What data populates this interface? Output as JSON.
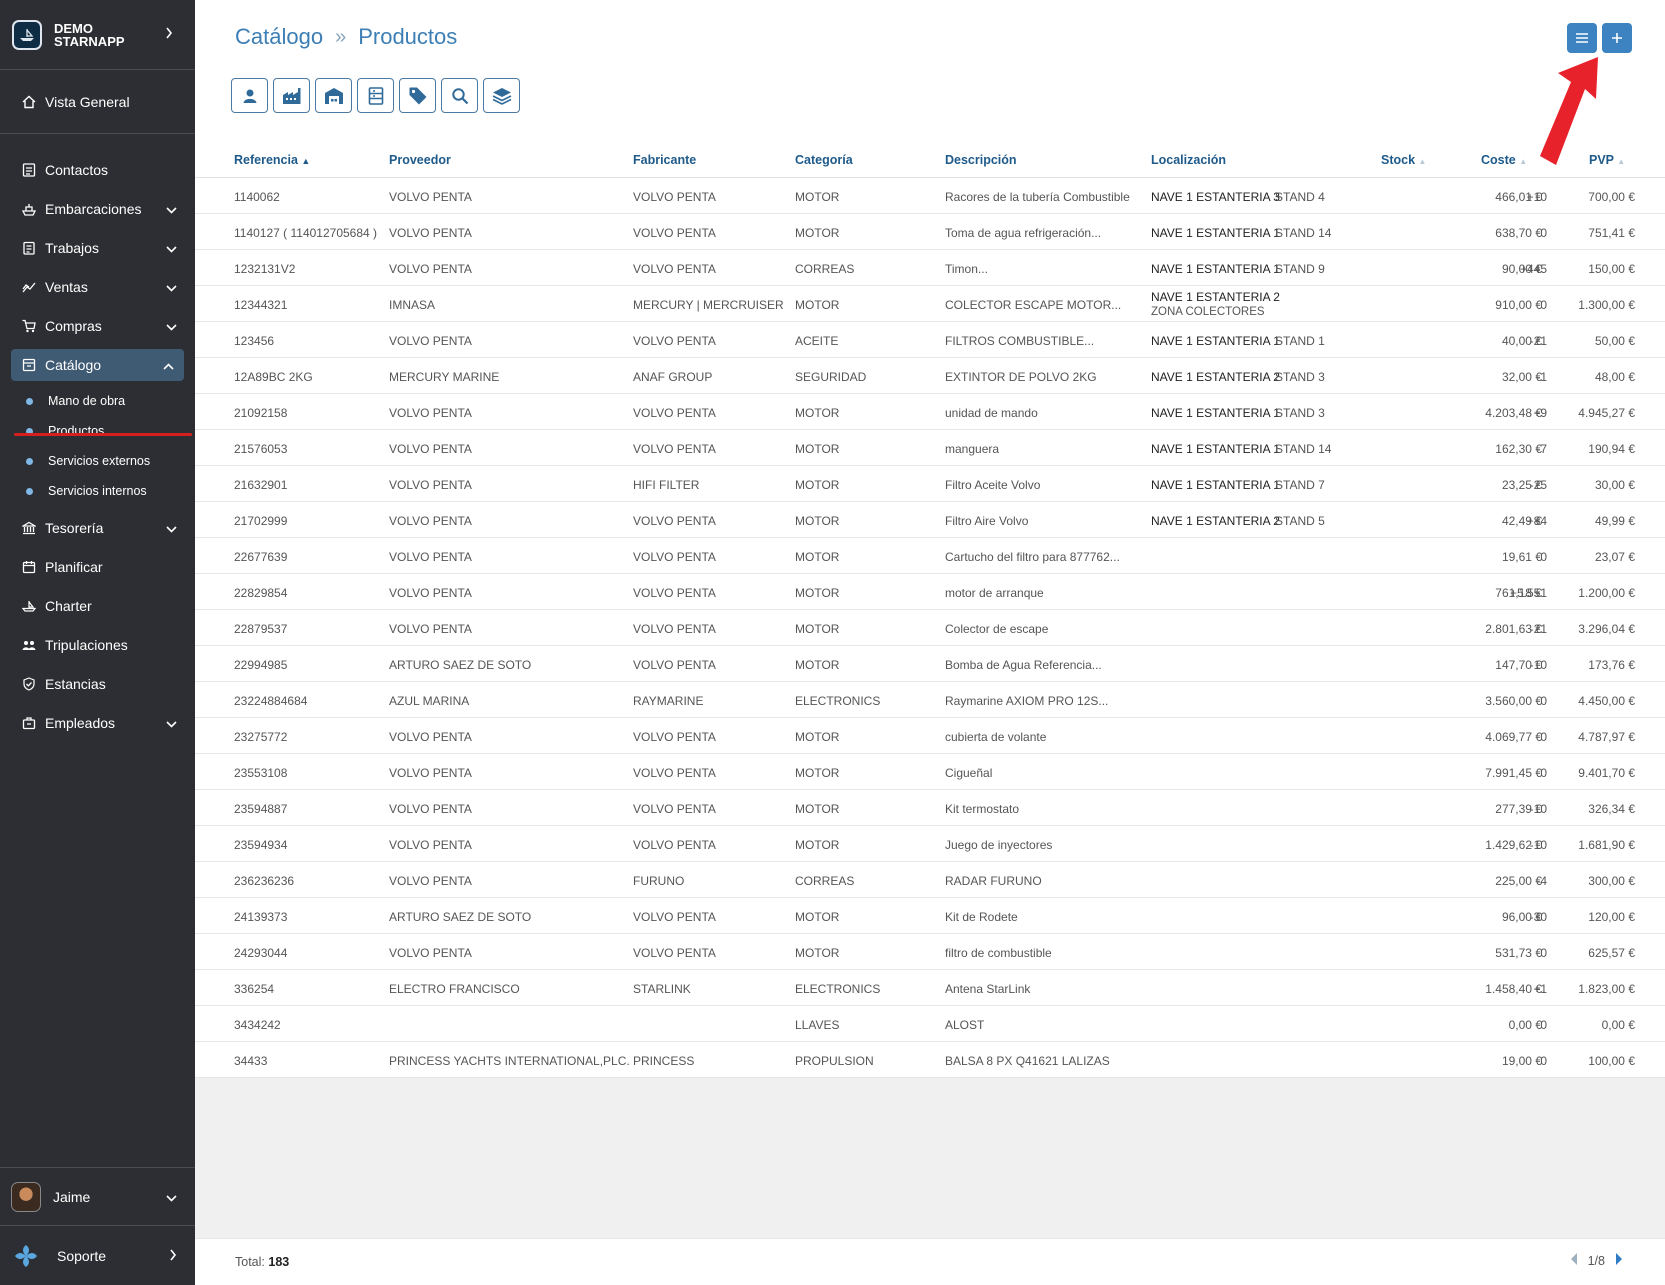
{
  "app": {
    "name_line1": "DEMO",
    "name_line2": "STARNAPP"
  },
  "sidebar": {
    "items": [
      {
        "label": "Vista General"
      },
      {
        "label": "Contactos"
      },
      {
        "label": "Embarcaciones"
      },
      {
        "label": "Trabajos"
      },
      {
        "label": "Ventas"
      },
      {
        "label": "Compras"
      },
      {
        "label": "Catálogo"
      },
      {
        "label": "Tesorería"
      },
      {
        "label": "Planificar"
      },
      {
        "label": "Charter"
      },
      {
        "label": "Tripulaciones"
      },
      {
        "label": "Estancias"
      },
      {
        "label": "Empleados"
      }
    ],
    "catalog_sub": [
      {
        "label": "Mano de obra"
      },
      {
        "label": "Productos"
      },
      {
        "label": "Servicios externos"
      },
      {
        "label": "Servicios internos"
      }
    ],
    "user": "Jaime",
    "support": "Soporte"
  },
  "breadcrumb": {
    "parent": "Catálogo",
    "current": "Productos"
  },
  "table": {
    "headers": {
      "ref": "Referencia",
      "prov": "Proveedor",
      "fab": "Fabricante",
      "cat": "Categoría",
      "desc": "Descripción",
      "loc": "Localización",
      "stock": "Stock",
      "coste": "Coste",
      "pvp": "PVP"
    },
    "rows": [
      {
        "ref": "1140062",
        "prov": "VOLVO PENTA",
        "fab": "VOLVO PENTA",
        "cat": "MOTOR",
        "desc": "Racores de la tubería Combustible",
        "loc1": "NAVE 1 ESTANTERIA 3",
        "loc2": "STAND 4",
        "stock": "+10",
        "coste": "466,01 €",
        "pvp": "700,00 €"
      },
      {
        "ref": "1140127 ( 114012705684 )",
        "prov": "VOLVO PENTA",
        "fab": "VOLVO PENTA",
        "cat": "MOTOR",
        "desc": "Toma de agua refrigeración...",
        "loc1": "NAVE 1 ESTANTERIA 1",
        "loc2": "STAND 14",
        "stock": "0",
        "coste": "638,70 €",
        "pvp": "751,41 €"
      },
      {
        "ref": "1232131V2",
        "prov": "VOLVO PENTA",
        "fab": "VOLVO PENTA",
        "cat": "CORREAS",
        "desc": "Timon...",
        "loc1": "NAVE 1 ESTANTERIA 1",
        "loc2": "STAND 9",
        "stock": "+445",
        "coste": "90,00 €",
        "pvp": "150,00 €"
      },
      {
        "ref": "12344321",
        "prov": "IMNASA",
        "fab": "MERCURY | MERCRUISER",
        "cat": "MOTOR",
        "desc": "COLECTOR ESCAPE MOTOR...",
        "loc1": "NAVE 1 ESTANTERIA 2",
        "loc2": "ZONA COLECTORES",
        "stock": "0",
        "coste": "910,00 €",
        "pvp": "1.300,00 €"
      },
      {
        "ref": "123456",
        "prov": "VOLVO PENTA",
        "fab": "VOLVO PENTA",
        "cat": "ACEITE",
        "desc": "FILTROS COMBUSTIBLE...",
        "loc1": "NAVE 1 ESTANTERIA 1",
        "loc2": "STAND 1",
        "stock": "-21",
        "coste": "40,00 €",
        "pvp": "50,00 €"
      },
      {
        "ref": "12A89BC 2KG",
        "prov": "MERCURY MARINE",
        "fab": "ANAF GROUP",
        "cat": "SEGURIDAD",
        "desc": "EXTINTOR DE POLVO 2KG",
        "loc1": "NAVE 1 ESTANTERIA 2",
        "loc2": "STAND 3",
        "stock": "-1",
        "coste": "32,00 €",
        "pvp": "48,00 €"
      },
      {
        "ref": "21092158",
        "prov": "VOLVO PENTA",
        "fab": "VOLVO PENTA",
        "cat": "MOTOR",
        "desc": "unidad de mando",
        "loc1": "NAVE 1 ESTANTERIA 1",
        "loc2": "STAND 3",
        "stock": "+9",
        "coste": "4.203,48 €",
        "pvp": "4.945,27 €"
      },
      {
        "ref": "21576053",
        "prov": "VOLVO PENTA",
        "fab": "VOLVO PENTA",
        "cat": "MOTOR",
        "desc": "manguera",
        "loc1": "NAVE 1 ESTANTERIA 1",
        "loc2": "STAND 14",
        "stock": "-7",
        "coste": "162,30 €",
        "pvp": "190,94 €"
      },
      {
        "ref": "21632901",
        "prov": "VOLVO PENTA",
        "fab": "HIFI FILTER",
        "cat": "MOTOR",
        "desc": "Filtro Aceite Volvo",
        "loc1": "NAVE 1 ESTANTERIA 1",
        "loc2": "STAND 7",
        "stock": "-25",
        "coste": "23,25 €",
        "pvp": "30,00 €"
      },
      {
        "ref": "21702999",
        "prov": "VOLVO PENTA",
        "fab": "VOLVO PENTA",
        "cat": "MOTOR",
        "desc": "Filtro Aire Volvo",
        "loc1": "NAVE 1 ESTANTERIA 2",
        "loc2": "STAND 5",
        "stock": "+84",
        "coste": "42,49 €",
        "pvp": "49,99 €"
      },
      {
        "ref": "22677639",
        "prov": "VOLVO PENTA",
        "fab": "VOLVO PENTA",
        "cat": "MOTOR",
        "desc": "Cartucho del filtro para 877762...",
        "loc1": "",
        "loc2": "",
        "stock": "0",
        "coste": "19,61 €",
        "pvp": "23,07 €"
      },
      {
        "ref": "22829854",
        "prov": "VOLVO PENTA",
        "fab": "VOLVO PENTA",
        "cat": "MOTOR",
        "desc": "motor de arranque",
        "loc1": "",
        "loc2": "",
        "stock": "+5.551",
        "coste": "761,18 €",
        "pvp": "1.200,00 €"
      },
      {
        "ref": "22879537",
        "prov": "VOLVO PENTA",
        "fab": "VOLVO PENTA",
        "cat": "MOTOR",
        "desc": "Colector de escape",
        "loc1": "",
        "loc2": "",
        "stock": "-21",
        "coste": "2.801,63 €",
        "pvp": "3.296,04 €"
      },
      {
        "ref": "22994985",
        "prov": "ARTURO SAEZ DE SOTO",
        "fab": "VOLVO PENTA",
        "cat": "MOTOR",
        "desc": "Bomba de Agua Referencia...",
        "loc1": "",
        "loc2": "",
        "stock": "-10",
        "coste": "147,70 €",
        "pvp": "173,76 €"
      },
      {
        "ref": "23224884684",
        "prov": "AZUL MARINA",
        "fab": "RAYMARINE",
        "cat": "ELECTRONICS",
        "desc": "Raymarine AXIOM PRO 12S...",
        "loc1": "",
        "loc2": "",
        "stock": "0",
        "coste": "3.560,00 €",
        "pvp": "4.450,00 €"
      },
      {
        "ref": "23275772",
        "prov": "VOLVO PENTA",
        "fab": "VOLVO PENTA",
        "cat": "MOTOR",
        "desc": "cubierta de volante",
        "loc1": "",
        "loc2": "",
        "stock": "0",
        "coste": "4.069,77 €",
        "pvp": "4.787,97 €"
      },
      {
        "ref": "23553108",
        "prov": "VOLVO PENTA",
        "fab": "VOLVO PENTA",
        "cat": "MOTOR",
        "desc": "Cigueñal",
        "loc1": "",
        "loc2": "",
        "stock": "0",
        "coste": "7.991,45 €",
        "pvp": "9.401,70 €"
      },
      {
        "ref": "23594887",
        "prov": "VOLVO PENTA",
        "fab": "VOLVO PENTA",
        "cat": "MOTOR",
        "desc": "Kit termostato",
        "loc1": "",
        "loc2": "",
        "stock": "-10",
        "coste": "277,39 €",
        "pvp": "326,34 €"
      },
      {
        "ref": "23594934",
        "prov": "VOLVO PENTA",
        "fab": "VOLVO PENTA",
        "cat": "MOTOR",
        "desc": "Juego de inyectores",
        "loc1": "",
        "loc2": "",
        "stock": "-10",
        "coste": "1.429,62 €",
        "pvp": "1.681,90 €"
      },
      {
        "ref": "236236236",
        "prov": "VOLVO PENTA",
        "fab": "FURUNO",
        "cat": "CORREAS",
        "desc": "RADAR FURUNO",
        "loc1": "",
        "loc2": "",
        "stock": "-4",
        "coste": "225,00 €",
        "pvp": "300,00 €"
      },
      {
        "ref": "24139373",
        "prov": "ARTURO SAEZ DE SOTO",
        "fab": "VOLVO PENTA",
        "cat": "MOTOR",
        "desc": "Kit de Rodete",
        "loc1": "",
        "loc2": "",
        "stock": "-30",
        "coste": "96,00 €",
        "pvp": "120,00 €"
      },
      {
        "ref": "24293044",
        "prov": "VOLVO PENTA",
        "fab": "VOLVO PENTA",
        "cat": "MOTOR",
        "desc": "filtro de combustible",
        "loc1": "",
        "loc2": "",
        "stock": "0",
        "coste": "531,73 €",
        "pvp": "625,57 €"
      },
      {
        "ref": "336254",
        "prov": "ELECTRO FRANCISCO",
        "fab": "STARLINK",
        "cat": "ELECTRONICS",
        "desc": "Antena StarLink",
        "loc1": "",
        "loc2": "",
        "stock": "+1",
        "coste": "1.458,40 €",
        "pvp": "1.823,00 €"
      },
      {
        "ref": "3434242",
        "prov": "",
        "fab": "",
        "cat": "LLAVES",
        "desc": "ALOST",
        "loc1": "",
        "loc2": "",
        "stock": "0",
        "coste": "0,00 €",
        "pvp": "0,00 €"
      },
      {
        "ref": "34433",
        "prov": "PRINCESS YACHTS INTERNATIONAL,PLC.",
        "fab": "PRINCESS",
        "cat": "PROPULSION",
        "desc": "BALSA 8 PX Q41621 LALIZAS",
        "loc1": "",
        "loc2": "",
        "stock": "0",
        "coste": "19,00 €",
        "pvp": "100,00 €"
      }
    ]
  },
  "footer": {
    "total_label": "Total:",
    "total_value": "183",
    "page": "1/8"
  },
  "colors": {
    "sidebar": "#2c2e33",
    "accent": "#3d82c1",
    "annotation": "#e8222a"
  }
}
